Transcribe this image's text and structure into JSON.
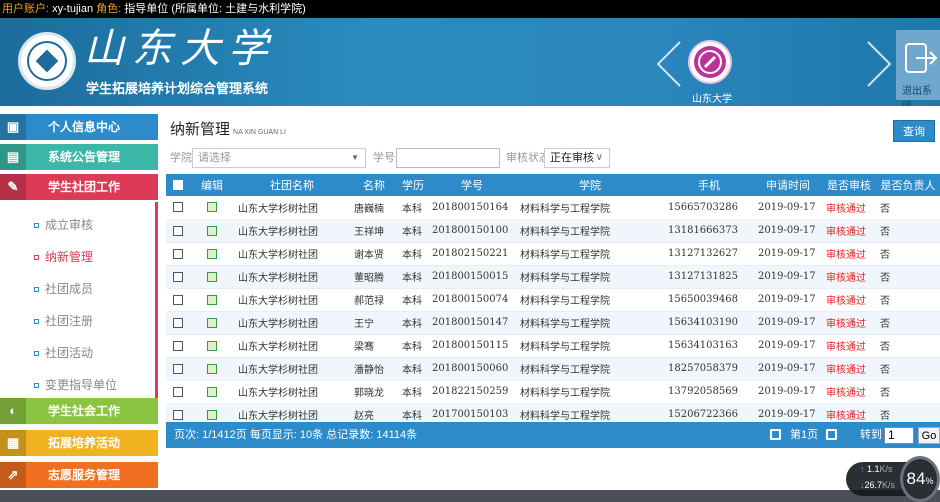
{
  "topbar": {
    "account_label": "用户账户:",
    "account_value": "xy-tujian",
    "role_label": "角色:",
    "role_value": "指导单位 (所属单位: 土建与水利学院)"
  },
  "header": {
    "logo_script": "山东大学",
    "system_title": "学生拓展培养计划综合管理系统",
    "school_label": "山东大学",
    "logout_label": "退出系统"
  },
  "sidebar": {
    "nav_top": [
      {
        "label": "个人信息中心",
        "icon": "user-card-icon",
        "color": "#2d8bc9"
      },
      {
        "label": "系统公告管理",
        "icon": "notice-icon",
        "color": "#3bb7a8"
      },
      {
        "label": "学生社团工作",
        "icon": "pen-icon",
        "color": "#dd3a56"
      }
    ],
    "sub_items": [
      {
        "label": "成立审核"
      },
      {
        "label": "纳新管理"
      },
      {
        "label": "社团成员"
      },
      {
        "label": "社团注册"
      },
      {
        "label": "社团活动"
      },
      {
        "label": "变更指导单位"
      }
    ],
    "nav_bottom": [
      {
        "label": "学生社会工作",
        "icon": "social-icon",
        "color": "#8bc441"
      },
      {
        "label": "拓展培养活动",
        "icon": "calendar-icon",
        "color": "#f0b220"
      },
      {
        "label": "志愿服务管理",
        "icon": "share-icon",
        "color": "#f07022"
      }
    ]
  },
  "main": {
    "title": "纳新管理",
    "title_pinyin": "NA XIN GUAN LI",
    "query_label": "查询",
    "filters": {
      "college_label": "学院",
      "college_placeholder": "请选择",
      "student_id_label": "学号",
      "status_label": "审核状态",
      "status_value": "正在审核"
    },
    "table": {
      "headers": [
        "",
        "编辑",
        "社团名称",
        "名称",
        "学历",
        "学号",
        "学院",
        "手机",
        "申请时间",
        "是否审核",
        "是否负责人"
      ],
      "rows": [
        {
          "club": "山东大学杉树社团",
          "name": "唐巍楠",
          "degree": "本科",
          "sid": "201800150164",
          "college": "材料科学与工程学院",
          "phone": "15665703286",
          "date": "2019-09-17",
          "audit": "审核通过",
          "leader": "否"
        },
        {
          "club": "山东大学杉树社团",
          "name": "王祥坤",
          "degree": "本科",
          "sid": "201800150100",
          "college": "材料科学与工程学院",
          "phone": "13181666373",
          "date": "2019-09-17",
          "audit": "审核通过",
          "leader": "否"
        },
        {
          "club": "山东大学杉树社团",
          "name": "谢本贤",
          "degree": "本科",
          "sid": "201802150221",
          "college": "材料科学与工程学院",
          "phone": "13127132627",
          "date": "2019-09-17",
          "audit": "审核通过",
          "leader": "否"
        },
        {
          "club": "山东大学杉树社团",
          "name": "董昭腾",
          "degree": "本科",
          "sid": "201800150015",
          "college": "材料科学与工程学院",
          "phone": "13127131825",
          "date": "2019-09-17",
          "audit": "审核通过",
          "leader": "否"
        },
        {
          "club": "山东大学杉树社团",
          "name": "郝范禄",
          "degree": "本科",
          "sid": "201800150074",
          "college": "材料科学与工程学院",
          "phone": "15650039468",
          "date": "2019-09-17",
          "audit": "审核通过",
          "leader": "否"
        },
        {
          "club": "山东大学杉树社团",
          "name": "王宁",
          "degree": "本科",
          "sid": "201800150147",
          "college": "材料科学与工程学院",
          "phone": "15634103190",
          "date": "2019-09-17",
          "audit": "审核通过",
          "leader": "否"
        },
        {
          "club": "山东大学杉树社团",
          "name": "梁骞",
          "degree": "本科",
          "sid": "201800150115",
          "college": "材料科学与工程学院",
          "phone": "15634103163",
          "date": "2019-09-17",
          "audit": "审核通过",
          "leader": "否"
        },
        {
          "club": "山东大学杉树社团",
          "name": "潘静怡",
          "degree": "本科",
          "sid": "201800150060",
          "college": "材料科学与工程学院",
          "phone": "18257058379",
          "date": "2019-09-17",
          "audit": "审核通过",
          "leader": "否"
        },
        {
          "club": "山东大学杉树社团",
          "name": "郭晓龙",
          "degree": "本科",
          "sid": "201822150259",
          "college": "材料科学与工程学院",
          "phone": "13792058569",
          "date": "2019-09-17",
          "audit": "审核通过",
          "leader": "否"
        },
        {
          "club": "山东大学杉树社团",
          "name": "赵亮",
          "degree": "本科",
          "sid": "201700150103",
          "college": "材料科学与工程学院",
          "phone": "15206722366",
          "date": "2019-09-17",
          "audit": "审核通过",
          "leader": "否"
        }
      ]
    },
    "pager": {
      "summary": "页次: 1/1412页 每页显示: 10条 总记录数: 14114条",
      "current_page": "第1页",
      "jump_label": "转到",
      "jump_value": "1",
      "go_label": "Go"
    }
  },
  "net_widget": {
    "up": "1.1",
    "up_unit": "K/s",
    "down": "26.7",
    "down_unit": "K/s",
    "percent": "84",
    "percent_unit": "%"
  }
}
